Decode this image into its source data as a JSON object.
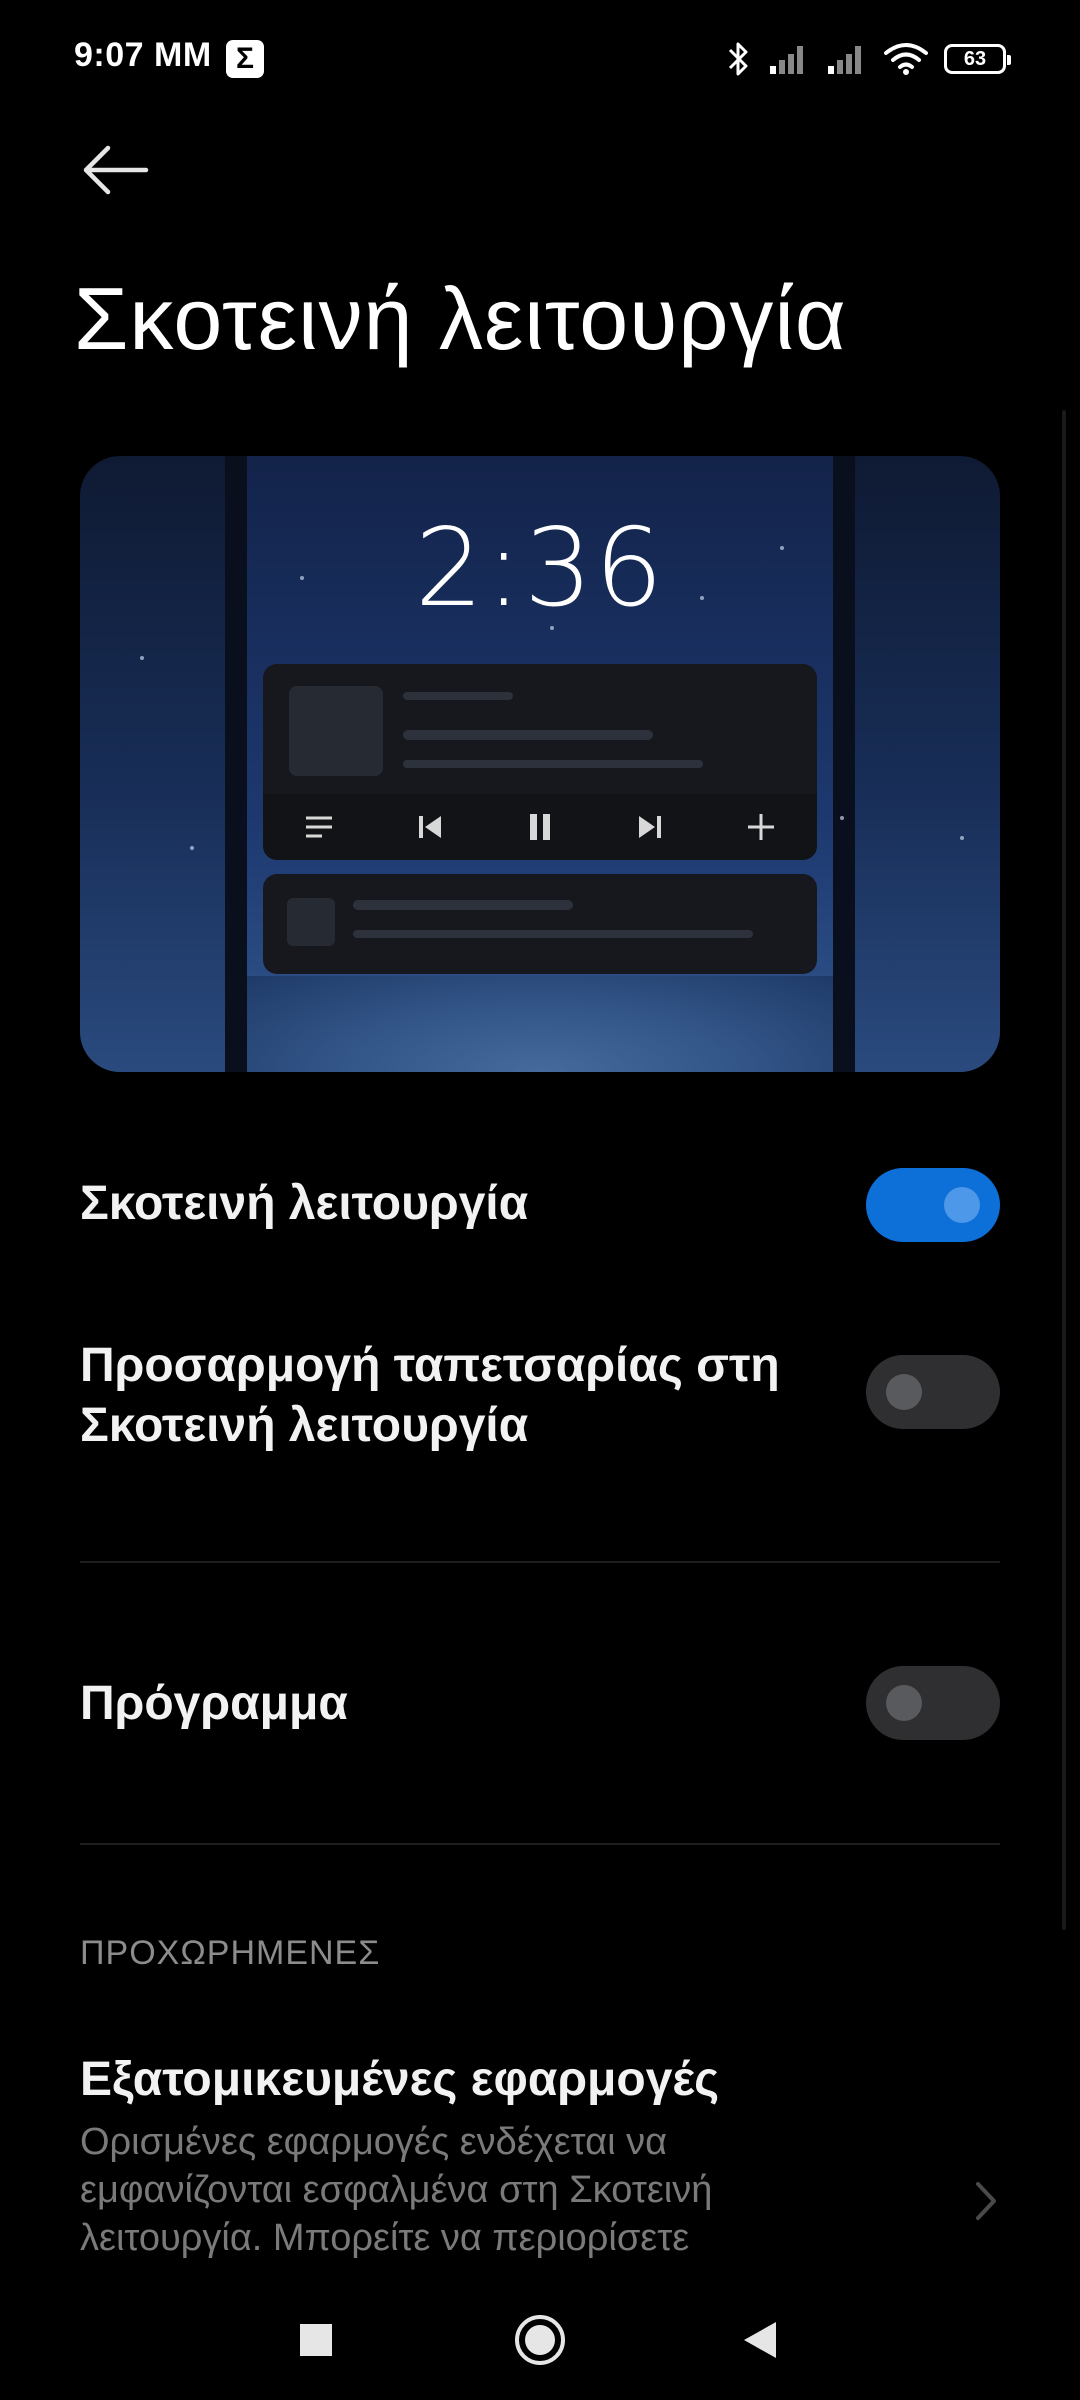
{
  "status_bar": {
    "time": "9:07 ΜΜ",
    "sigma_icon": "Σ",
    "icons": [
      "bluetooth-icon",
      "signal-icon",
      "signal-icon",
      "wifi-icon"
    ],
    "battery_level": "63"
  },
  "header": {
    "back_icon": "arrow-left-icon",
    "title": "Σκοτεινή λειτουργία"
  },
  "preview": {
    "clock": "2:36",
    "media_controls": [
      "playlist-icon",
      "previous-icon",
      "pause-icon",
      "next-icon",
      "add-icon"
    ]
  },
  "settings": {
    "dark_mode": {
      "label": "Σκοτεινή λειτουργία",
      "enabled": true,
      "accent": "#0d6fd8"
    },
    "wallpaper": {
      "label_line1": "Προσαρμογή ταπετσαρίας στη",
      "label_line2": "Σκοτεινή λειτουργία",
      "enabled": false
    },
    "schedule": {
      "label": "Πρόγραμμα",
      "enabled": false
    }
  },
  "advanced": {
    "header": "ΠΡΟΧΩΡΗΜΕΝΕΣ",
    "custom_apps": {
      "title": "Εξατομικευμένες εφαρμογές",
      "description": "Ορισμένες εφαρμογές ενδέχεται να εμφανίζονται εσφαλμένα στη Σκοτεινή λειτουργία. Μπορείτε να περιορίσετε"
    }
  },
  "nav_bar": {
    "buttons": [
      "recents-square-icon",
      "home-circle-icon",
      "back-triangle-icon"
    ]
  }
}
